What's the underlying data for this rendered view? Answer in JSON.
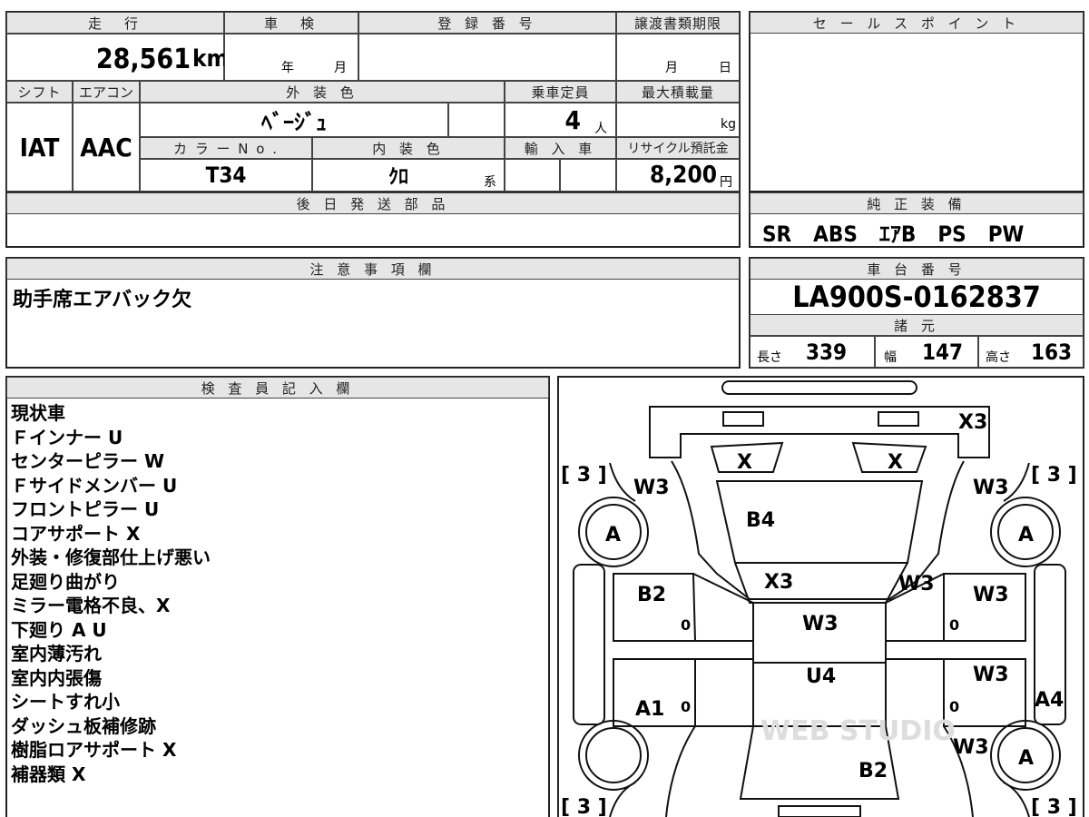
{
  "top": {
    "mileage_label": "走　行",
    "inspection_label": "車　検",
    "registration_label": "登 録 番 号",
    "transfer_label": "譲渡書類期限",
    "sales_point_label": "セ ー ル ス ポ イ ン ト",
    "mileage_value": "28,561",
    "mileage_unit": "km",
    "year_unit": "年",
    "month_unit": "月",
    "transfer_month": "月",
    "transfer_day": "日"
  },
  "spec": {
    "shift_label": "シフト",
    "ac_label": "エアコン",
    "exterior_color_label": "外 装 色",
    "capacity_label": "乗車定員",
    "max_load_label": "最大積載量",
    "shift_value": "IAT",
    "ac_value": "AAC",
    "exterior_color_value": "ﾍﾞｰｼﾞｭ",
    "capacity_value": "4",
    "capacity_unit": "人",
    "max_load_unit": "kg",
    "color_no_label": "カ ラ ー N o .",
    "interior_color_label": "内 装 色",
    "import_label": "輸 入 車",
    "recycle_label": "リサイクル預託金",
    "color_no_value": "T34",
    "interior_color_value": "ｸﾛ",
    "interior_color_suffix": "系",
    "recycle_value": "8,200",
    "recycle_unit": "円"
  },
  "later_parts": {
    "label": "後 日 発 送 部 品",
    "value": ""
  },
  "genuine_equipment": {
    "label": "純 正 装 備",
    "value": "SR　ABS　ｴｱB　PS　PW"
  },
  "notes": {
    "label": "注 意 事 項 欄",
    "value": "助手席エアバック欠"
  },
  "chassis": {
    "label": "車 台 番 号",
    "value": "LA900S-0162837"
  },
  "dimensions": {
    "label": "諸 元",
    "length_label": "長さ",
    "length_value": "339",
    "width_label": "幅",
    "width_value": "147",
    "height_label": "高さ",
    "height_value": "163"
  },
  "inspector": {
    "label": "検 査 員 記 入 欄",
    "lines": [
      "現状車",
      "Ｆインナー U",
      "センターピラー W",
      "Ｆサイドメンバー U",
      "フロントピラー U",
      "コアサポート X",
      "外装・修復部仕上げ悪い",
      "足廻り曲がり",
      "ミラー電格不良、X",
      "下廻り A U",
      "室内薄汚れ",
      "室内内張傷",
      "シートすれ小",
      "ダッシュ板補修跡",
      "樹脂ロアサポート X",
      "補器類 X"
    ]
  },
  "diagram": {
    "marks": [
      "X3",
      "X",
      "X",
      "W3",
      "W3",
      "B4",
      "A",
      "A",
      "X3",
      "W3",
      "B2",
      "W3",
      "W3",
      "U4",
      "W3",
      "A1",
      "A4",
      "W3",
      "A",
      "B2",
      "0",
      "0",
      "0",
      "0"
    ],
    "tire_labels": [
      "[ 3 ]",
      "[ 3 ]",
      "[ 3 ]",
      "[ 3 ]"
    ],
    "watermark": "WEB STUDIO"
  }
}
